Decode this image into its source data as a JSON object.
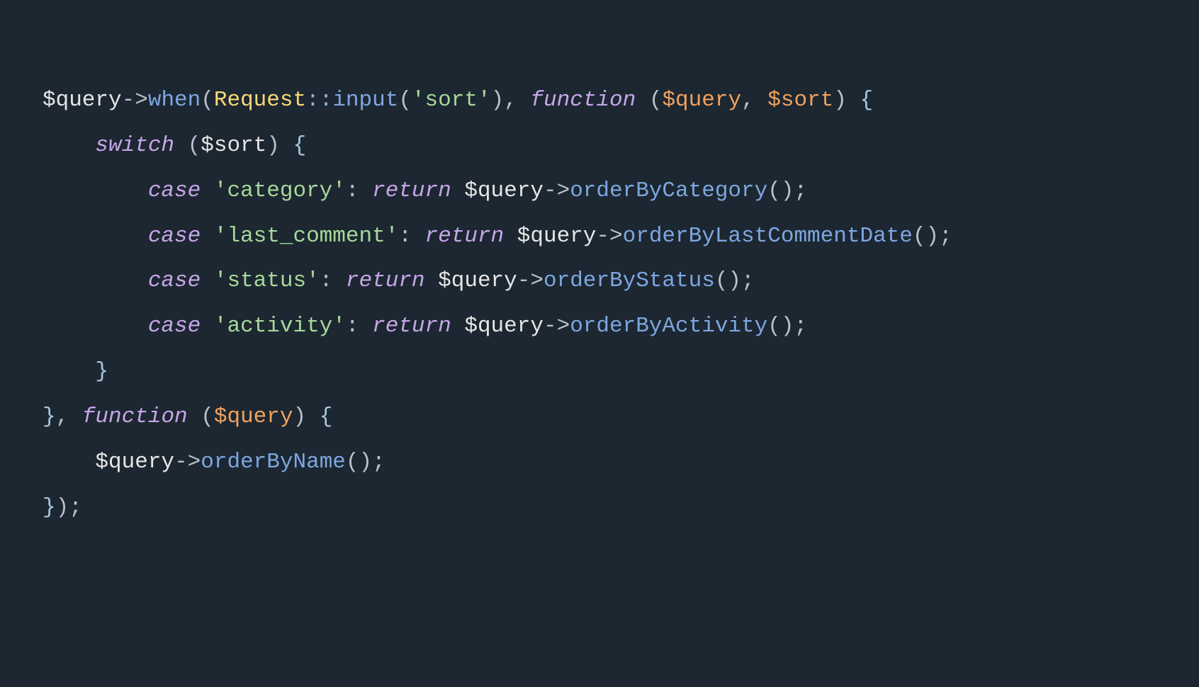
{
  "code": {
    "line1": {
      "var1": "$query",
      "arrow1": "->",
      "method_when": "when",
      "open1": "(",
      "class_request": "Request",
      "dbl_colon": "::",
      "method_input": "input",
      "open2": "(",
      "str_sort": "'sort'",
      "close2": ")",
      "comma1": ", ",
      "kw_function": "function",
      "space_open3": " (",
      "var2": "$query",
      "comma2": ", ",
      "var3": "$sort",
      "close3": ")",
      "space_brace": " {",
      "brace_open": ""
    },
    "line2": {
      "indent": "    ",
      "kw_switch": "switch",
      "space_open": " (",
      "var_sort": "$sort",
      "close": ")",
      "space_brace": " {"
    },
    "cases": [
      {
        "indent": "        ",
        "kw_case": "case",
        "sp": " ",
        "str": "'category'",
        "colon": ": ",
        "kw_return": "return",
        "sp2": " ",
        "var": "$query",
        "arrow": "->",
        "method": "orderByCategory",
        "call": "();"
      },
      {
        "indent": "        ",
        "kw_case": "case",
        "sp": " ",
        "str": "'last_comment'",
        "colon": ": ",
        "kw_return": "return",
        "sp2": " ",
        "var": "$query",
        "arrow": "->",
        "method": "orderByLastCommentDate",
        "call": "();"
      },
      {
        "indent": "        ",
        "kw_case": "case",
        "sp": " ",
        "str": "'status'",
        "colon": ": ",
        "kw_return": "return",
        "sp2": " ",
        "var": "$query",
        "arrow": "->",
        "method": "orderByStatus",
        "call": "();"
      },
      {
        "indent": "        ",
        "kw_case": "case",
        "sp": " ",
        "str": "'activity'",
        "colon": ": ",
        "kw_return": "return",
        "sp2": " ",
        "var": "$query",
        "arrow": "->",
        "method": "orderByActivity",
        "call": "();"
      }
    ],
    "line7": {
      "indent": "    ",
      "brace_close": "}"
    },
    "line8": {
      "brace_close": "}",
      "comma": ", ",
      "kw_function": "function",
      "space_open": " (",
      "var": "$query",
      "close": ")",
      "space_brace": " {"
    },
    "line9": {
      "indent": "    ",
      "var": "$query",
      "arrow": "->",
      "method": "orderByName",
      "call": "();"
    },
    "line10": {
      "brace_close": "}",
      "close_sem": ");"
    }
  }
}
